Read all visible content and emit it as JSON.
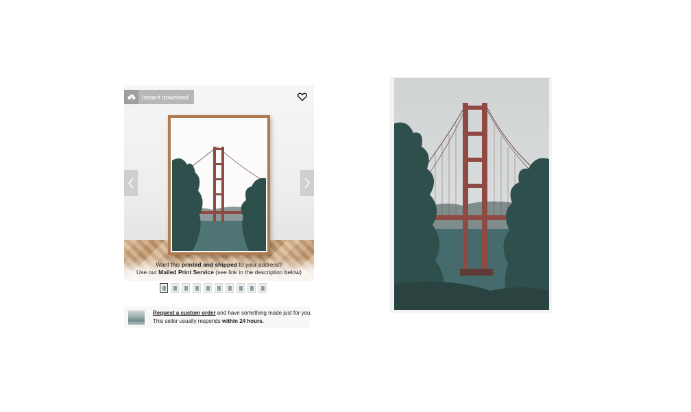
{
  "listing": {
    "badge_label": "Instant download",
    "overlay_line1_pre": "Want this ",
    "overlay_line1_bold": "printed and shipped",
    "overlay_line1_post": " to your address?",
    "overlay_line2_pre": "Use our ",
    "overlay_line2_bold": "Mailed Print Service",
    "overlay_line2_post": " (see link in the description below)",
    "thumbnail_count": 10,
    "active_thumbnail": 0
  },
  "custom_order": {
    "link_text": "Request a custom order",
    "line1_rest": " and have something made just for you.",
    "line2_pre": "This seller usually responds ",
    "line2_bold": "within 24 hours."
  },
  "colors": {
    "bridge": "#8f4a43",
    "sky": "#d9dcdc",
    "trees": "#2f4f4c",
    "water": "#456b6c",
    "frame": "#b07a4f"
  },
  "icons": {
    "badge": "cloud-download-icon",
    "favorite": "heart-icon",
    "prev": "chevron-left-icon",
    "next": "chevron-right-icon"
  }
}
